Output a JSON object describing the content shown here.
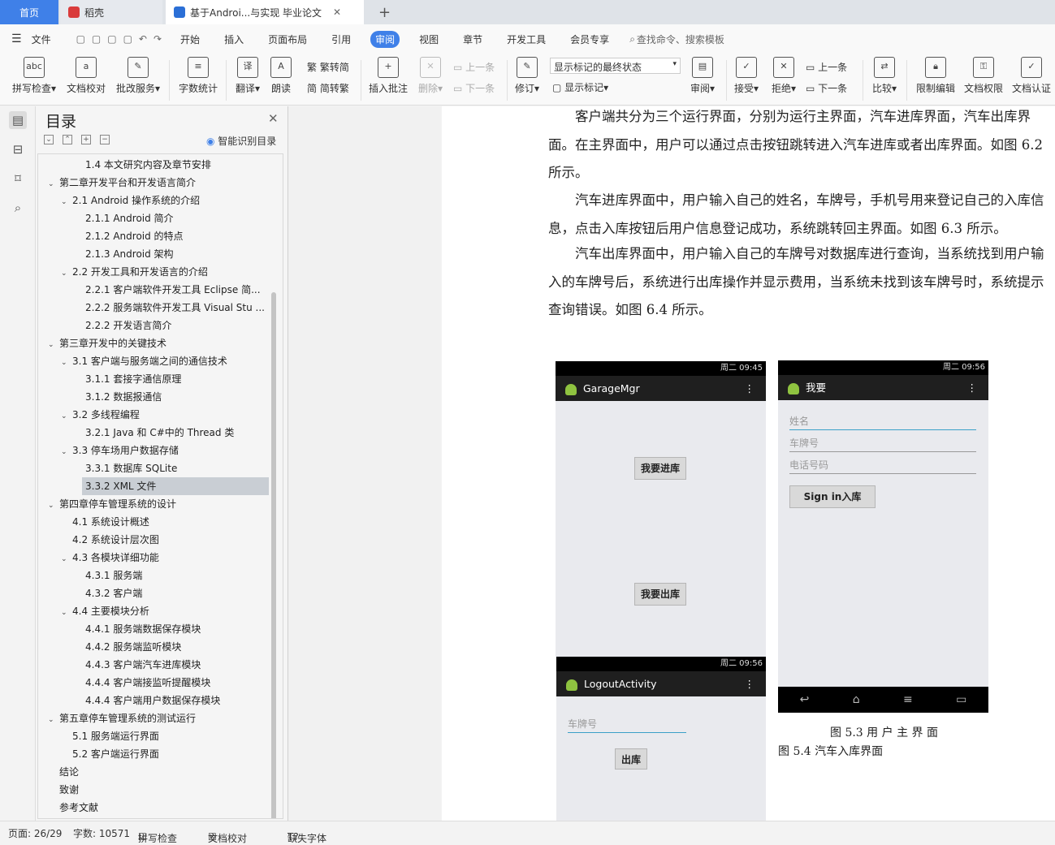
{
  "tabs": {
    "home": "首页",
    "wps": "稻壳",
    "doc": "基于Androi...与实现 毕业论文"
  },
  "menu": [
    "文件",
    "开始",
    "插入",
    "页面布局",
    "引用",
    "审阅",
    "视图",
    "章节",
    "开发工具",
    "会员专享"
  ],
  "search_placeholder": "查找命令、搜索模板",
  "ribbon": {
    "spell": "拼写检查",
    "proof": "文档校对",
    "batch": "批改服务",
    "wordcount": "字数统计",
    "translate": "翻译",
    "read": "朗读",
    "t2s": "繁转简",
    "s2t": "简转繁",
    "comment": "插入批注",
    "delete": "删除",
    "prev": "上一条",
    "next": "下一条",
    "revise": "修订",
    "markup_state": "显示标记的最终状态",
    "show_markup": "显示标记",
    "review": "审阅",
    "accept": "接受",
    "reject": "拒绝",
    "prev2": "上一条",
    "next2": "下一条",
    "compare": "比较",
    "restrict": "限制编辑",
    "perm": "文档权限",
    "cert": "文档认证"
  },
  "nav": {
    "title": "目录",
    "smart": "智能识别目录",
    "items": [
      {
        "label": "1.4 本文研究内容及章节安排",
        "level": 2,
        "arrow": ""
      },
      {
        "label": "第二章开发平台和开发语言简介",
        "level": 0,
        "arrow": "v"
      },
      {
        "label": "2.1 Android 操作系统的介绍",
        "level": 1,
        "arrow": "v"
      },
      {
        "label": "2.1.1 Android 简介",
        "level": 2,
        "arrow": ""
      },
      {
        "label": "2.1.2 Android 的特点",
        "level": 2,
        "arrow": ""
      },
      {
        "label": "2.1.3 Android 架构",
        "level": 2,
        "arrow": ""
      },
      {
        "label": "2.2 开发工具和开发语言的介绍",
        "level": 1,
        "arrow": "v"
      },
      {
        "label": "2.2.1   客户端软件开发工具 Eclipse 简...",
        "level": 2,
        "arrow": ""
      },
      {
        "label": "2.2.2 服务端软件开发工具 Visual Stu ...",
        "level": 2,
        "arrow": ""
      },
      {
        "label": "2.2.2 开发语言简介",
        "level": 2,
        "arrow": ""
      },
      {
        "label": "第三章开发中的关键技术",
        "level": 0,
        "arrow": "v"
      },
      {
        "label": "3.1 客户端与服务端之间的通信技术",
        "level": 1,
        "arrow": "v"
      },
      {
        "label": "3.1.1 套接字通信原理",
        "level": 2,
        "arrow": ""
      },
      {
        "label": "3.1.2 数据报通信",
        "level": 2,
        "arrow": ""
      },
      {
        "label": "3.2 多线程编程",
        "level": 1,
        "arrow": "v"
      },
      {
        "label": "3.2.1   Java 和 C#中的 Thread 类",
        "level": 2,
        "arrow": ""
      },
      {
        "label": "3.3 停车场用户数据存储",
        "level": 1,
        "arrow": "v"
      },
      {
        "label": "3.3.1 数据库 SQLite",
        "level": 2,
        "arrow": ""
      },
      {
        "label": "3.3.2 XML 文件",
        "level": 2,
        "arrow": "",
        "selected": true
      },
      {
        "label": "第四章停车管理系统的设计",
        "level": 0,
        "arrow": "v"
      },
      {
        "label": "4.1 系统设计概述",
        "level": 1,
        "arrow": ""
      },
      {
        "label": "4.2   系统设计层次图",
        "level": 1,
        "arrow": ""
      },
      {
        "label": "4.3 各模块详细功能",
        "level": 1,
        "arrow": "v"
      },
      {
        "label": "4.3.1 服务端",
        "level": 2,
        "arrow": ""
      },
      {
        "label": "4.3.2 客户端",
        "level": 2,
        "arrow": ""
      },
      {
        "label": "4.4 主要模块分析",
        "level": 1,
        "arrow": "v"
      },
      {
        "label": "4.4.1 服务端数据保存模块",
        "level": 2,
        "arrow": ""
      },
      {
        "label": "4.4.2 服务端监听模块",
        "level": 2,
        "arrow": ""
      },
      {
        "label": "4.4.3 客户端汽车进库模块",
        "level": 2,
        "arrow": ""
      },
      {
        "label": "4.4.4 客户端接监听提醒模块",
        "level": 2,
        "arrow": ""
      },
      {
        "label": "4.4.4 客户端用户数据保存模块",
        "level": 2,
        "arrow": ""
      },
      {
        "label": "第五章停车管理系统的测试运行",
        "level": 0,
        "arrow": "v"
      },
      {
        "label": "5.1 服务端运行界面",
        "level": 1,
        "arrow": ""
      },
      {
        "label": "5.2 客户端运行界面",
        "level": 1,
        "arrow": ""
      },
      {
        "label": "结论",
        "level": 0,
        "arrow": ""
      },
      {
        "label": "致谢",
        "level": 0,
        "arrow": ""
      },
      {
        "label": "参考文献",
        "level": 0,
        "arrow": ""
      }
    ]
  },
  "doc": {
    "p1": "客户端共分为三个运行界面，分别为运行主界面，汽车进库界面，汽车出库界面。在主界面中，用户可以通过点击按钮跳转进入汽车进库或者出库界面。如图 6.2 所示。",
    "p2": "汽车进库界面中，用户输入自己的姓名，车牌号，手机号用来登记自己的入库信息，点击入库按钮后用户信息登记成功，系统跳转回主界面。如图 6.3 所示。",
    "p3": "汽车出库界面中，用户输入自己的车牌号对数据库进行查询，当系统找到用户输入的车牌号后，系统进行出库操作并显示费用，当系统未找到该车牌号时，系统提示查询错误。如图 6.4 所示。",
    "phone1": {
      "time": "周二 09:45",
      "title": "GarageMgr",
      "btn_in": "我要进库",
      "btn_out": "我要出库"
    },
    "phone2": {
      "time": "周二 09:56",
      "title": "我要",
      "f_name": "姓名",
      "f_plate": "车牌号",
      "f_phone": "电话号码",
      "btn": "Sign in入库"
    },
    "phone3": {
      "time": "周二 09:56",
      "title": "LogoutActivity",
      "f_plate": "车牌号",
      "btn": "出库"
    },
    "cap1": "图   5.3   用  户  主  界  面",
    "cap2": "图 5.4 汽车入库界面"
  },
  "status": {
    "page": "页面: 26/29",
    "words": "字数: 10571",
    "spell": "拼写检查",
    "proof": "文档校对",
    "font": "缺失字体"
  }
}
